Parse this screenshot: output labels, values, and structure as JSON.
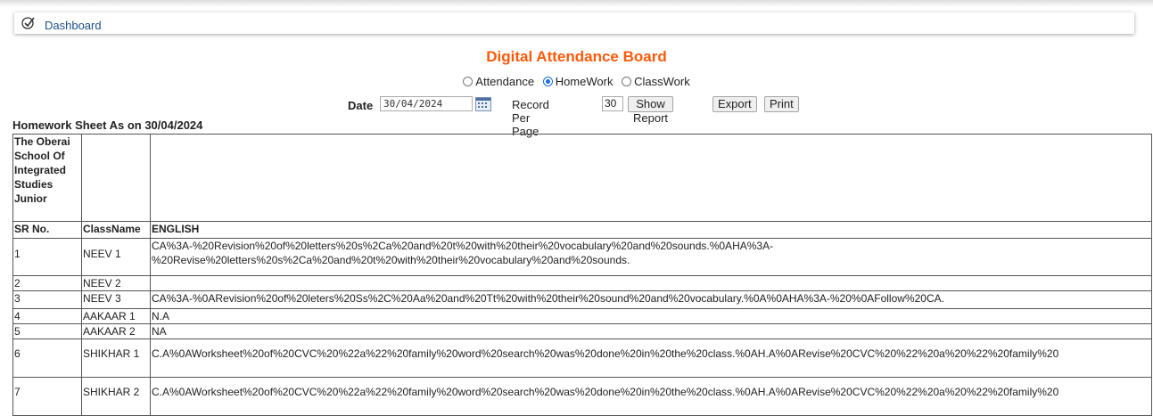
{
  "nav": {
    "dashboard_label": "Dashboard"
  },
  "board": {
    "title": "Digital Attendance Board",
    "options": [
      {
        "label": "Attendance",
        "selected": false
      },
      {
        "label": "HomeWork",
        "selected": true
      },
      {
        "label": "ClassWork",
        "selected": false
      }
    ]
  },
  "filters": {
    "date_label": "Date",
    "date_value": "30/04/2024",
    "records_label": "Record Per Page",
    "records_value": "30",
    "show_report": "Show Report",
    "export": "Export",
    "print": "Print"
  },
  "sheet": {
    "title": "Homework Sheet As on 30/04/2024",
    "school": "The Oberai School Of Integrated Studies Junior",
    "headers": {
      "sr": "SR No.",
      "class": "ClassName",
      "subject": "ENGLISH"
    },
    "rows": [
      {
        "sr": "1",
        "class": "NEEV 1",
        "text": "CA%3A-%20Revision%20of%20letters%20s%2Ca%20and%20t%20with%20their%20vocabulary%20and%20sounds.%0AHA%3A- %20Revise%20letters%20s%2Ca%20and%20t%20with%20their%20vocabulary%20and%20sounds."
      },
      {
        "sr": "2",
        "class": "NEEV 2",
        "text": ""
      },
      {
        "sr": "3",
        "class": "NEEV 3",
        "text": "CA%3A-%0ARevision%20of%20leters%20Ss%2C%20Aa%20and%20Tt%20with%20their%20sound%20and%20vocabulary.%0A%0AHA%3A-%20%0AFollow%20CA."
      },
      {
        "sr": "4",
        "class": "AAKAAR 1",
        "text": "N.A"
      },
      {
        "sr": "5",
        "class": "AAKAAR 2",
        "text": "NA"
      },
      {
        "sr": "6",
        "class": "SHIKHAR 1",
        "text": "C.A%0AWorksheet%20of%20CVC%20%22a%22%20family%20word%20search%20was%20done%20in%20the%20class.%0AH.A%0ARevise%20CVC%20%22%20a%20%22%20family%20"
      },
      {
        "sr": "7",
        "class": "SHIKHAR 2",
        "text": "C.A%0AWorksheet%20of%20CVC%20%22a%22%20family%20word%20search%20was%20done%20in%20the%20class.%0AH.A%0ARevise%20CVC%20%22%20a%20%22%20family%20"
      }
    ]
  }
}
